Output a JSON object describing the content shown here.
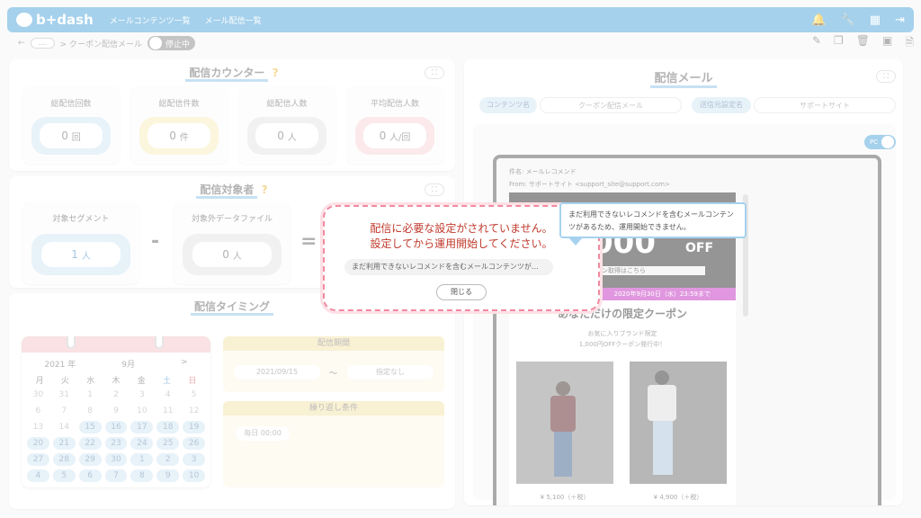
{
  "header": {
    "brand": "b+dash",
    "nav": [
      "メールコンテンツ一覧",
      "メール配信一覧"
    ]
  },
  "subbar": {
    "back": "←",
    "dots": "…",
    "breadcrumb": "> クーポン配信メール",
    "toggle_label": "停止中"
  },
  "counter": {
    "title": "配信カウンター",
    "cards": [
      {
        "label": "総配信回数",
        "value": "0",
        "unit": "回"
      },
      {
        "label": "総配信件数",
        "value": "0",
        "unit": "件"
      },
      {
        "label": "総配信人数",
        "value": "0",
        "unit": "人"
      },
      {
        "label": "平均配信人数",
        "value": "0",
        "unit": "人/回"
      }
    ]
  },
  "target": {
    "title": "配信対象者",
    "segment_label": "対象セグメント",
    "segment_value": "1",
    "segment_unit": "人",
    "exclude_label": "対象外データファイル",
    "exclude_value": "0",
    "exclude_unit": "人",
    "minus": "-",
    "equals": "="
  },
  "timing": {
    "title": "配信タイミング",
    "period_label": "配信期間",
    "start": "2021/09/15",
    "tilde": "～",
    "end": "指定なし",
    "repeat_label": "繰り返し条件",
    "repeat_value": "毎日 00:00"
  },
  "calendar": {
    "year": "2021 年",
    "month": "9月",
    "next": ">",
    "weekdays": [
      "月",
      "火",
      "水",
      "木",
      "金",
      "土",
      "日"
    ],
    "days": [
      "30",
      "31",
      "1",
      "2",
      "3",
      "4",
      "5",
      "6",
      "7",
      "8",
      "9",
      "10",
      "11",
      "12",
      "13",
      "14",
      "15",
      "16",
      "17",
      "18",
      "19",
      "20",
      "21",
      "22",
      "23",
      "24",
      "25",
      "26",
      "27",
      "28",
      "29",
      "30",
      "1",
      "2",
      "3",
      "4",
      "5",
      "6",
      "7",
      "8",
      "9",
      "10"
    ]
  },
  "mail": {
    "title": "配信メール",
    "content_label": "コンテンツ名",
    "content_value": "クーポン配信メール",
    "sender_label": "送信元設定名",
    "sender_value": "サポートサイト",
    "pc": "PC",
    "subject": "件名: メールレコメンド",
    "from": "From: サポートサイト <support_site@support.com>",
    "banner_big": "000",
    "banner_off": "OFF",
    "banner_link": "ポン取得はこちら",
    "banner_date": "2020年9月30日（水）23:59まで",
    "headline": "あなただけの限定クーポン",
    "desc1": "お気に入りブランド限定",
    "desc2": "1,000円OFFクーポン発行中！",
    "price1": "¥ 5,100（＋税）",
    "price2": "¥ 4,900（＋税）"
  },
  "modal": {
    "line1": "配信に必要な設定がされていません。",
    "line2": "設定してから運用開始してください。",
    "msg": "まだ利用できないレコメンドを含むメールコンテンツが…",
    "close": "閉じる"
  },
  "tooltip": {
    "text": "まだ利用できないレコメンドを含むメールコンテンツがあるため、運用開始できません。"
  }
}
